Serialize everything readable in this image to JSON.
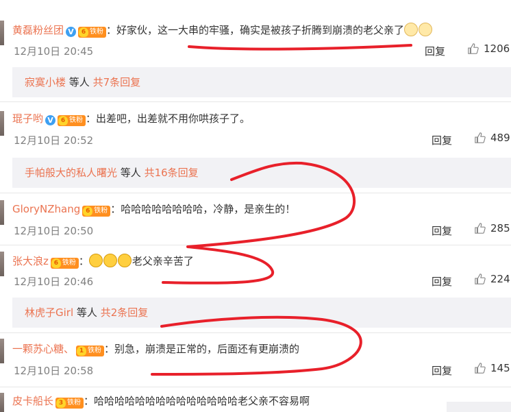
{
  "comments": [
    {
      "user": "黄磊粉丝团",
      "level": "6",
      "badge": "铁粉",
      "verified": true,
      "text": "：好家伙，这一大串的牢骚，确实是被孩子折腾到崩溃的老父亲了",
      "emoji_after": [
        "dog-face-icon",
        "dog-face-icon"
      ],
      "time": "12月10日 20:45",
      "reply": "回复",
      "likes": "1206"
    },
    {
      "user": "琨子哟",
      "level": "6",
      "badge": "铁粉",
      "verified": true,
      "text": "：出差吧，出差就不用你哄孩子了。",
      "time": "12月10日 20:52",
      "reply": "回复",
      "likes": "489"
    },
    {
      "user": "GloryNZhang",
      "level": "6",
      "badge": "铁粉",
      "verified": false,
      "text": "：哈哈哈哈哈哈哈哈，冷静，是亲生的！",
      "time": "12月10日 20:50",
      "reply": "回复",
      "likes": "285"
    },
    {
      "user": "张大浪z",
      "level": "6",
      "badge": "铁粉",
      "verified": false,
      "text": "老父亲辛苦了",
      "prefix": "：",
      "emoji_before": [
        "laugh-cry-icon",
        "laugh-cry-icon",
        "laugh-cry-icon"
      ],
      "time": "12月10日 20:46",
      "reply": "回复",
      "likes": "224"
    },
    {
      "user": "一颗苏心糖、",
      "level": "1",
      "badge": "铁粉",
      "verified": false,
      "text": "：别急，崩溃是正常的，后面还有更崩溃的",
      "time": "12月10日 20:58",
      "reply": "回复",
      "likes": "145"
    },
    {
      "user": "皮卡船长",
      "level": "3",
      "badge": "铁粉",
      "verified": false,
      "text": "：哈哈哈哈哈哈哈哈哈哈哈哈哈哈老父亲不容易啊"
    }
  ],
  "sub_replies": [
    {
      "name": "寂寞小楼",
      "mid": " 等人 ",
      "count": "共7条回复"
    },
    {
      "name": "手帕般大的私人曙光",
      "mid": " 等人 ",
      "count": "共16条回复"
    },
    {
      "name": "林虎子Girl",
      "mid": " 等人 ",
      "count": "共2条回复"
    }
  ],
  "colors": {
    "username": "#eb7350",
    "scribble": "#e8202a"
  }
}
